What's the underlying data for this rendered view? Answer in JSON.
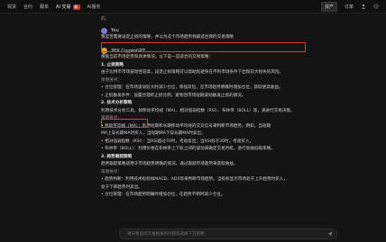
{
  "nav": {
    "items": [
      {
        "label": "现货",
        "active": false
      },
      {
        "label": "合约",
        "active": false
      },
      {
        "label": "跟单",
        "active": false
      },
      {
        "label": "AI 交易",
        "active": true,
        "badge": "新"
      },
      {
        "label": "AI服务",
        "active": false
      }
    ],
    "right_button": "资产",
    "right_link": "订单"
  },
  "chat": {
    "prev_tail": "的。",
    "user": {
      "name": "You",
      "message": "我是否需要设定止损的策略，并以为这个市场趋势找最适合我的交易策略"
    },
    "bot": {
      "name": "3EX CryptoGPT",
      "intro": "根据当前市场走势和具体情况，以下是一些适合的交易策略：",
      "sections": [
        {
          "title": "1. 止损策略",
          "sub": "止损策略：",
          "lines": [
            "由于比特币市场波动性较高，设定止损策略可以帮助您避免在不利市场条件下出现较大损失的风险。",
            "策略要点：",
            "• 仓位管理：在市场波动较大时减少仓位，降低风险，在市场趋势明确时增加仓位，获取更高收益。",
            "• 止损触发条件：设置合理的止损比例，避免因市场短期波动触发止损的情况。"
          ]
        },
        {
          "title": "2. 技术分析策略",
          "sub": "",
          "lines": [
            "利用技术分析工具，如移动平均线（MA）、相对强弱指数（RSI）、布林带（BOLL）等，来进行交易决策。",
            "策略要点：",
            "• 移动平均线（MA）：利用短期和长期移动平均线的交叉信号来判断市场趋势。例如，当短期",
            "  MA上穿长期MA时买入，当短期MA下穿长期MA时卖出。",
            "• 相对强弱指数（RSI）：当RSI超过70时，考虑卖出；当RSI低于30时，考虑买入。",
            "• 布林带（BOLL）：利用价格在布林带上下轨之间的波动来确定交易时机，进行高抛低吸策略。"
          ]
        },
        {
          "title": "3. 趋势跟踪策略",
          "sub": "",
          "lines": [
            "趋势跟踪策略适用于市场趋势明确的情况，通过跟踪市场趋势来获取收益。",
            "策略要点：",
            "• 趋势判断：利用技术指标如MACD、ADX等来判断市场趋势。当指标显示市场处于上升趋势时买入，",
            "  处于下降趋势时卖出。",
            "• 仓位管理：在市场趋势明确时增加仓位，在趋势不明时减少仓位。"
          ]
        }
      ]
    }
  },
  "input": {
    "placeholder": "请向我提问交易相关的问题或选择下方策略"
  },
  "colors": {
    "highlight": "#e23a30",
    "background": "#141414",
    "accent_bot": "#e0a030",
    "accent_user": "#7a7ad8"
  }
}
